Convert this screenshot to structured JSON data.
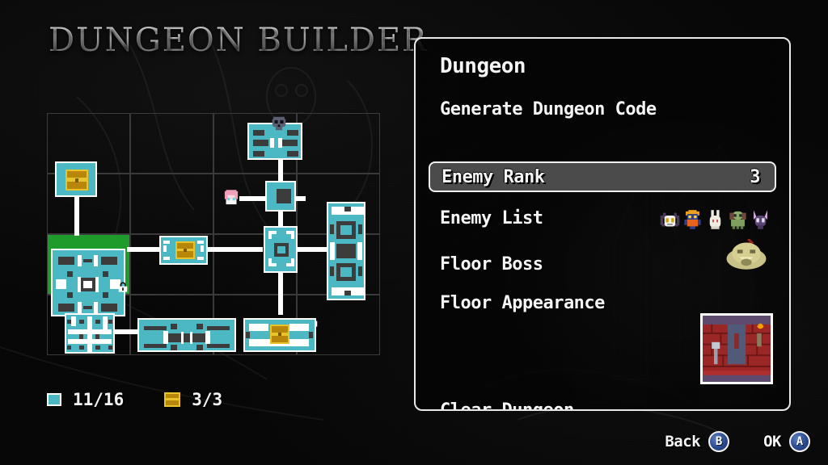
{
  "title": "DUNGEON BUILDER",
  "colors": {
    "room": "#4cb8c4",
    "cursor_green": "#1f9b2b",
    "chest_gold": "#e8c32a",
    "panel_border": "#e9e9e9",
    "highlight": "#4b4b4b",
    "button_blue": "#2b4a8f"
  },
  "legend": {
    "room_icon": "room-swatch-icon",
    "room_count": "11/16",
    "chest_icon": "treasure-chest-icon",
    "chest_count": "3/3"
  },
  "panel": {
    "title": "Dungeon",
    "items": [
      {
        "label": "Generate Dungeon Code",
        "value": "",
        "selected": false
      },
      {
        "label": "Enemy Rank",
        "value": "3",
        "selected": true
      },
      {
        "label": "Enemy List",
        "value": "",
        "selected": false
      },
      {
        "label": "Floor Boss",
        "value": "",
        "selected": false
      },
      {
        "label": "Floor Appearance",
        "value": "",
        "selected": false
      },
      {
        "label": "Clear Dungeon",
        "value": "",
        "selected": false
      }
    ],
    "enemy_list_icons": [
      "spider-enemy-icon",
      "armored-knight-enemy-icon",
      "rabbit-enemy-icon",
      "plant-enemy-icon",
      "bat-enemy-icon"
    ],
    "floor_boss_icon": "slime-boss-icon",
    "floor_appearance_preview": "red-brick-room-preview"
  },
  "footer": {
    "back_label": "Back",
    "back_button": "B",
    "ok_label": "OK",
    "ok_button": "A"
  },
  "map": {
    "grid_cols": 4,
    "grid_rows": 4,
    "markers": {
      "boss": "skull-icon",
      "player": "player-sprite",
      "locks": 2
    }
  }
}
